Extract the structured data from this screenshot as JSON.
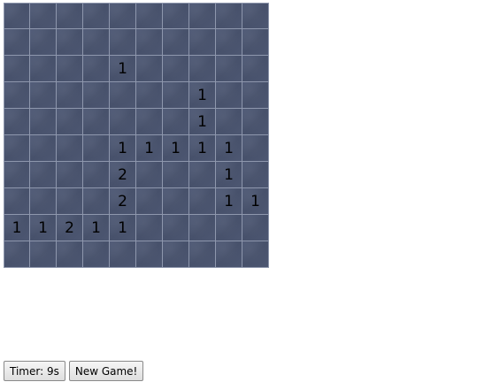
{
  "board": {
    "rows": 10,
    "cols": 10,
    "cells": [
      [
        "",
        "",
        "",
        "",
        "",
        "",
        "",
        "",
        "",
        ""
      ],
      [
        "",
        "",
        "",
        "",
        "",
        "",
        "",
        "",
        "",
        ""
      ],
      [
        "",
        "",
        "",
        "",
        "1",
        "",
        "",
        "",
        "",
        ""
      ],
      [
        "",
        "",
        "",
        "",
        "",
        "",
        "",
        "1",
        "",
        ""
      ],
      [
        "",
        "",
        "",
        "",
        "",
        "",
        "",
        "1",
        "",
        ""
      ],
      [
        "",
        "",
        "",
        "",
        "1",
        "1",
        "1",
        "1",
        "1",
        ""
      ],
      [
        "",
        "",
        "",
        "",
        "2",
        "",
        "",
        "",
        "1",
        ""
      ],
      [
        "",
        "",
        "",
        "",
        "2",
        "",
        "",
        "",
        "1",
        "1"
      ],
      [
        "1",
        "1",
        "2",
        "1",
        "1",
        "",
        "",
        "",
        "",
        ""
      ],
      [
        "",
        "",
        "",
        "",
        "",
        "",
        "",
        "",
        "",
        ""
      ]
    ],
    "colors": {
      "tile": "#4b5570",
      "gridline": "#8e97ad",
      "number": "#000000"
    }
  },
  "controls": {
    "timer_label": "Timer: 9s",
    "new_game_label": "New Game!"
  }
}
